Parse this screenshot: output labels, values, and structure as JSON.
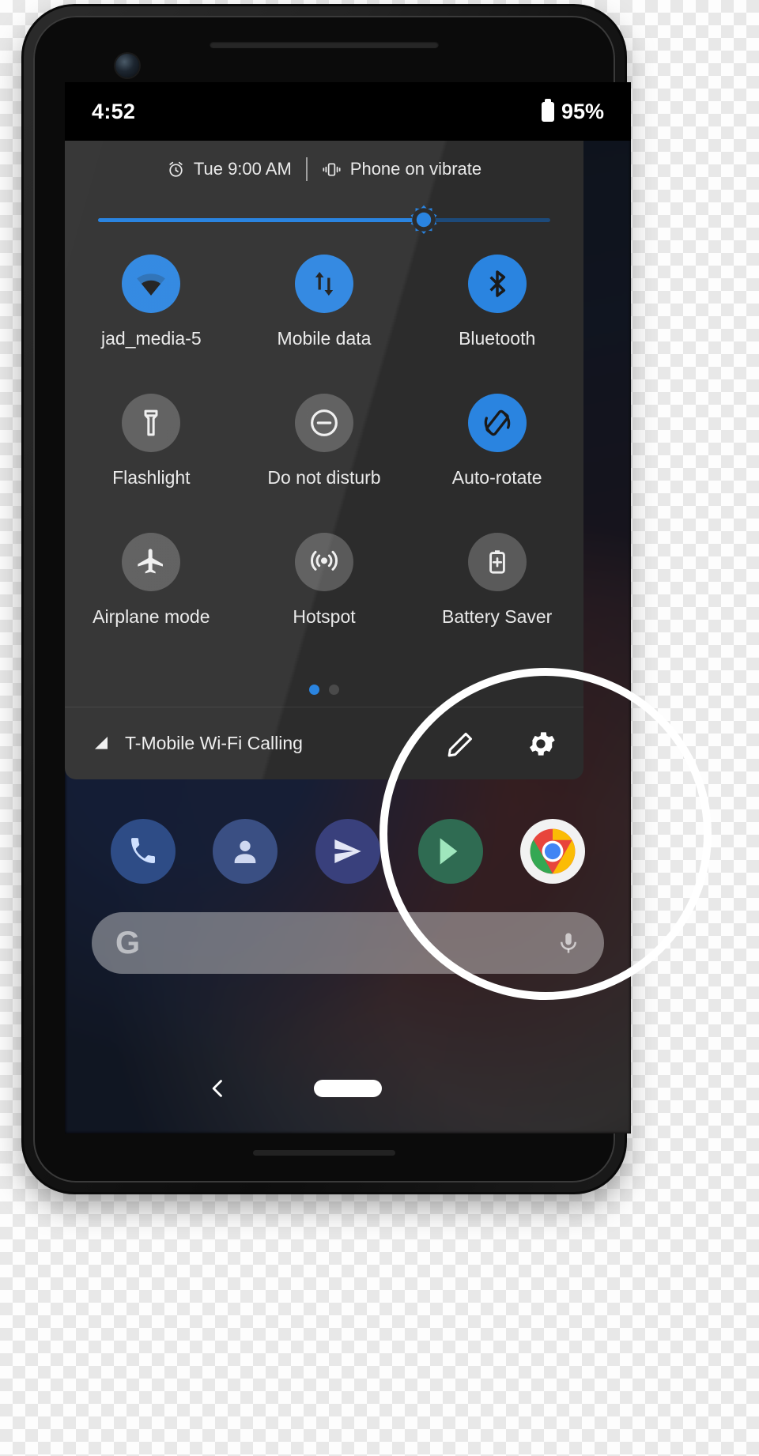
{
  "status_bar": {
    "time": "4:52",
    "battery_percent": "95%",
    "battery_icon": "battery-full-icon"
  },
  "quick_settings": {
    "header": {
      "alarm_icon": "alarm-clock-icon",
      "alarm_text": "Tue 9:00 AM",
      "vibrate_icon": "vibrate-icon",
      "ringer_text": "Phone on vibrate"
    },
    "brightness": {
      "icon": "brightness-sun-icon",
      "value_percent": 72,
      "fill_color": "#2a84e0",
      "track_color": "#1d4a7a"
    },
    "tiles": [
      {
        "label": "jad_media-5",
        "icon": "wifi-icon",
        "active": true
      },
      {
        "label": "Mobile data",
        "icon": "mobile-data-icon",
        "active": true
      },
      {
        "label": "Bluetooth",
        "icon": "bluetooth-icon",
        "active": true
      },
      {
        "label": "Flashlight",
        "icon": "flashlight-icon",
        "active": false
      },
      {
        "label": "Do not disturb",
        "icon": "do-not-disturb-icon",
        "active": false
      },
      {
        "label": "Auto-rotate",
        "icon": "auto-rotate-icon",
        "active": true
      },
      {
        "label": "Airplane mode",
        "icon": "airplane-icon",
        "active": false
      },
      {
        "label": "Hotspot",
        "icon": "hotspot-icon",
        "active": false
      },
      {
        "label": "Battery Saver",
        "icon": "battery-saver-icon",
        "active": false
      }
    ],
    "pager": {
      "pages": 2,
      "current": 1
    },
    "footer": {
      "carrier_icon": "signal-bars-icon",
      "carrier_text": "T-Mobile Wi-Fi Calling",
      "edit_icon": "pencil-edit-icon",
      "settings_icon": "gear-icon"
    }
  },
  "home_screen": {
    "dock": [
      {
        "name": "Phone",
        "icon": "phone-icon"
      },
      {
        "name": "Contacts",
        "icon": "contacts-icon"
      },
      {
        "name": "Messages",
        "icon": "paper-plane-icon"
      },
      {
        "name": "Play",
        "icon": "play-store-icon"
      },
      {
        "name": "Chrome",
        "icon": "chrome-icon"
      }
    ],
    "search": {
      "logo": "G",
      "mic_icon": "microphone-icon"
    },
    "nav": {
      "back_icon": "back-chevron-icon",
      "home_icon": "home-pill-icon"
    }
  },
  "annotation": {
    "shape": "circle-highlight",
    "color": "#ffffff"
  },
  "theme": {
    "accent": "#2a84e0",
    "panel_bg": "#2c2c2c",
    "tile_off": "#5a5a5a"
  }
}
